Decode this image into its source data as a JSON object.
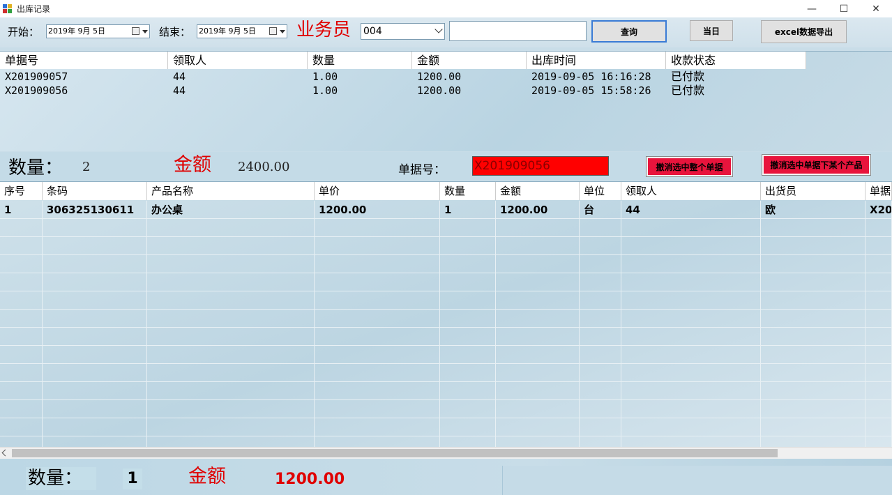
{
  "window": {
    "title": "出库记录",
    "minimize": "—",
    "maximize": "☐",
    "close": "✕"
  },
  "toolbar": {
    "start_label": "开始：",
    "start_date": "2019年  9月  5日",
    "end_label": "结束：",
    "end_date": "2019年  9月  5日",
    "salesman_label": "业务员",
    "salesman_value": "004",
    "search_text": "",
    "query_button": "查询",
    "today_button": "当日",
    "export_button": "excel数据导出"
  },
  "orders_grid": {
    "columns": [
      "单据号",
      "领取人",
      "数量",
      "金额",
      "出库时间",
      "收款状态"
    ],
    "rows": [
      [
        "X201909057",
        "44",
        "1.00",
        "1200.00",
        "2019-09-05  16:16:28",
        "已付款"
      ],
      [
        "X201909056",
        "44",
        "1.00",
        "1200.00",
        "2019-09-05  15:58:26",
        "已付款"
      ]
    ]
  },
  "summary": {
    "qty_label": "数量：",
    "qty_value": "2",
    "amount_label": "金额",
    "amount_value": "2400.00",
    "doc_no_label": "单据号：",
    "doc_no_value": "X201909056",
    "cancel_order_button": "撤消选中整个单据",
    "cancel_product_button": "撤消选中单据下某个产品"
  },
  "detail_grid": {
    "columns": [
      "序号",
      "条码",
      "产品名称",
      "单价",
      "数量",
      "金额",
      "单位",
      "领取人",
      "出货员",
      "单据"
    ],
    "rows": [
      [
        "1",
        "306325130611",
        "办公桌",
        "1200.00",
        "1",
        "1200.00",
        "台",
        "44",
        "欧",
        "X20"
      ]
    ]
  },
  "bottom": {
    "qty_label": "数量：",
    "qty_value": "1",
    "amount_label": "金额",
    "amount_value": "1200.00"
  },
  "colors": {
    "accent_red": "#e00000",
    "highlight_red": "#ff0000",
    "button_red": "#e8143c"
  }
}
